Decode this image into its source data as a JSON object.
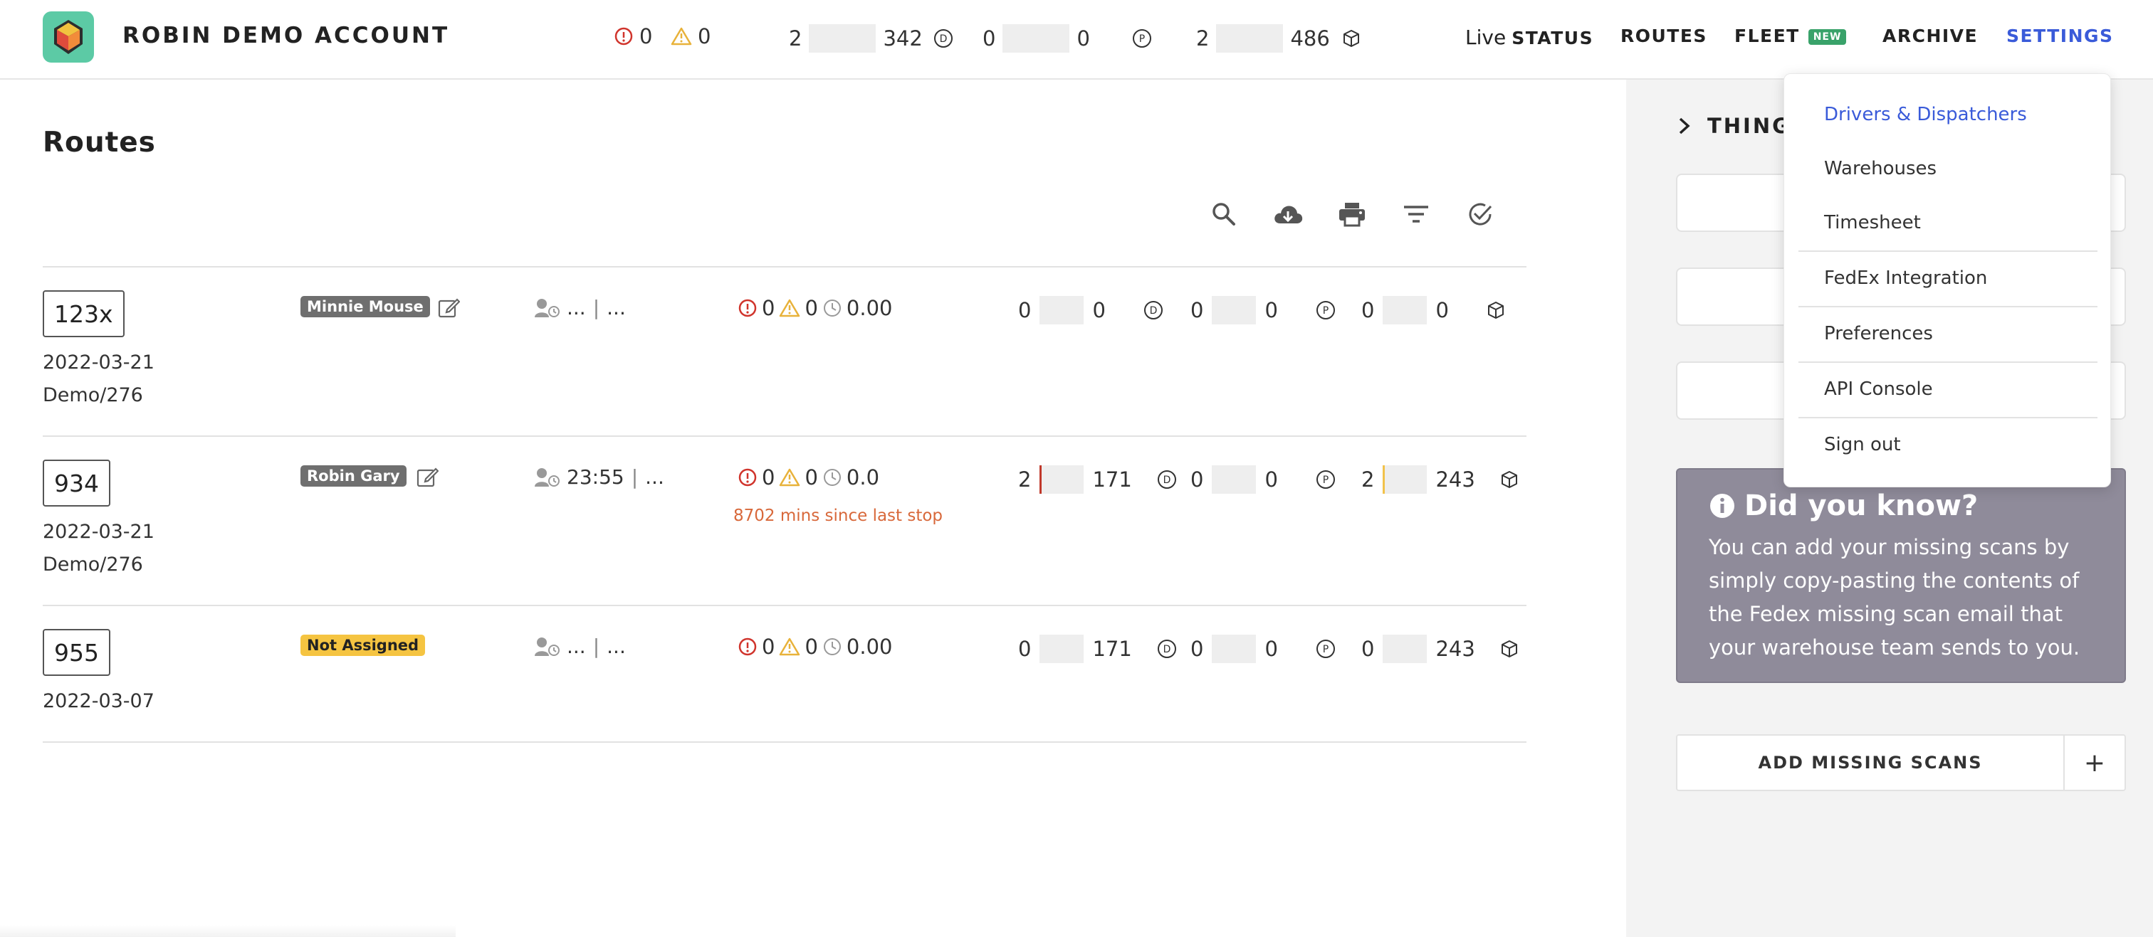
{
  "header": {
    "account_name": "ROBIN DEMO ACCOUNT",
    "errors": "0",
    "warnings": "0",
    "delivered": {
      "left": "2",
      "right": "342"
    },
    "pickup": {
      "left": "0",
      "right": "0"
    },
    "packages": {
      "left": "2",
      "right": "486"
    },
    "nav": {
      "live_label": "Live",
      "status": "STATUS",
      "routes": "ROUTES",
      "fleet": "FLEET",
      "fleet_badge": "NEW",
      "archive": "ARCHIVE",
      "settings": "SETTINGS"
    }
  },
  "main": {
    "title": "Routes",
    "toolbar_icons": [
      "search-icon",
      "cloud-download-icon",
      "print-icon",
      "filter-icon",
      "check-circle-icon"
    ],
    "rows": [
      {
        "route": "123x",
        "date": "2022-03-21",
        "demo": "Demo/276",
        "driver": "Minnie Mouse",
        "time_start": "...",
        "time_end": "...",
        "errors": "0",
        "warnings": "0",
        "duration": "0.00",
        "note": "",
        "delivered_left": "0",
        "delivered_right": "0",
        "pickup_left": "0",
        "pickup_right": "0",
        "package_left": "0",
        "package_right": "0"
      },
      {
        "route": "934",
        "date": "2022-03-21",
        "demo": "Demo/276",
        "driver": "Robin Gary",
        "time_start": "23:55",
        "time_end": "...",
        "errors": "0",
        "warnings": "0",
        "duration": "0.0",
        "note": "8702 mins since last stop",
        "delivered_left": "2",
        "delivered_right": "171",
        "pickup_left": "0",
        "pickup_right": "0",
        "package_left": "2",
        "package_right": "243"
      },
      {
        "route": "955",
        "date": "2022-03-07",
        "demo": "",
        "driver": "Not Assigned",
        "time_start": "...",
        "time_end": "...",
        "errors": "0",
        "warnings": "0",
        "duration": "0.00",
        "note": "",
        "delivered_left": "0",
        "delivered_right": "171",
        "pickup_left": "0",
        "pickup_right": "0",
        "package_left": "0",
        "package_right": "243"
      }
    ]
  },
  "right_panel": {
    "things_header": "THINGS",
    "did_you_know_title": "Did you know?",
    "did_you_know_body": "You can add your missing scans by simply copy-pasting the contents of the Fedex missing scan email that your warehouse team sends to you.",
    "add_missing_scans": "ADD MISSING SCANS",
    "add_plus": "+"
  },
  "settings_menu": {
    "items": [
      "Drivers & Dispatchers",
      "Warehouses",
      "Timesheet",
      "FedEx Integration",
      "Preferences",
      "API Console",
      "Sign out"
    ]
  },
  "colors": {
    "accent_blue": "#3a5bd9",
    "logo_green": "#5ccaa5",
    "badge_green": "#39a26a",
    "not_assigned_yellow": "#f5c441",
    "error_red": "#d0342c",
    "warning_amber": "#e8b23a",
    "note_orange": "#d8683a",
    "did_you_know_bg": "#8f8b9a"
  }
}
